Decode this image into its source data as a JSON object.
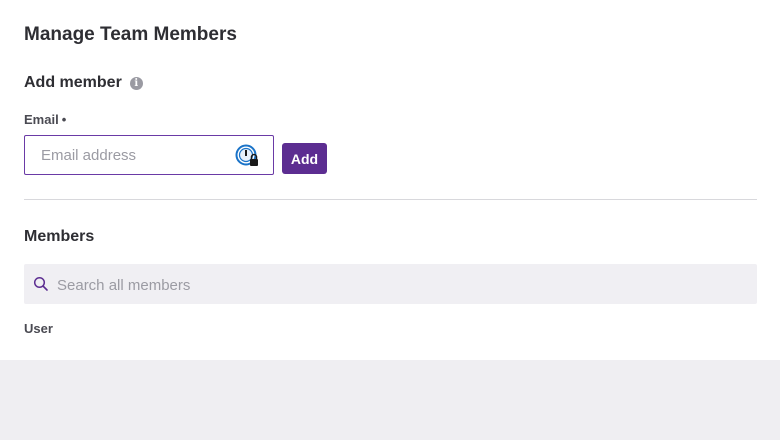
{
  "page": {
    "title": "Manage Team Members"
  },
  "add_member": {
    "title": "Add member",
    "info_icon": "info-icon",
    "email_label": "Email",
    "required_marker": "•",
    "email_placeholder": "Email address",
    "email_value": "",
    "password_manager_icon": "password-manager-lock-icon",
    "add_button_label": "Add"
  },
  "members": {
    "title": "Members",
    "search_placeholder": "Search all members",
    "search_value": "",
    "search_icon": "search-icon",
    "columns": [
      "User"
    ]
  },
  "colors": {
    "accent": "#5c2d91",
    "input_focus_border": "#6a3aa6",
    "page_background": "#efeef2",
    "panel_background": "#ffffff",
    "search_background": "#f0eff3"
  }
}
